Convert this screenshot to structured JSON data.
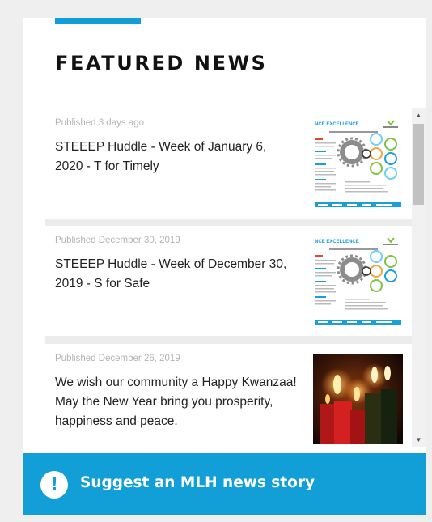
{
  "widget": {
    "heading": "FEATURED NEWS"
  },
  "news": [
    {
      "published": "Published 3 days ago",
      "title": "STEEEP Huddle - Week of January 6, 2020 - T for Timely",
      "thumb_header": "NCE EXCELLENCE"
    },
    {
      "published": "Published December 30, 2019",
      "title": "STEEEP Huddle - Week of December 30, 2019 - S for Safe",
      "thumb_header": "NCE EXCELLENCE"
    },
    {
      "published": "Published December 26, 2019",
      "title": "We wish our community a Happy Kwanzaa! May the New Year bring you prosperity, happiness and peace."
    }
  ],
  "cta": {
    "label": "Suggest an MLH news story",
    "icon": "exclamation-circle-icon"
  },
  "colors": {
    "accent": "#129fd8",
    "heading": "#111111",
    "meta": "#b4b4b4",
    "background": "#efefef"
  }
}
